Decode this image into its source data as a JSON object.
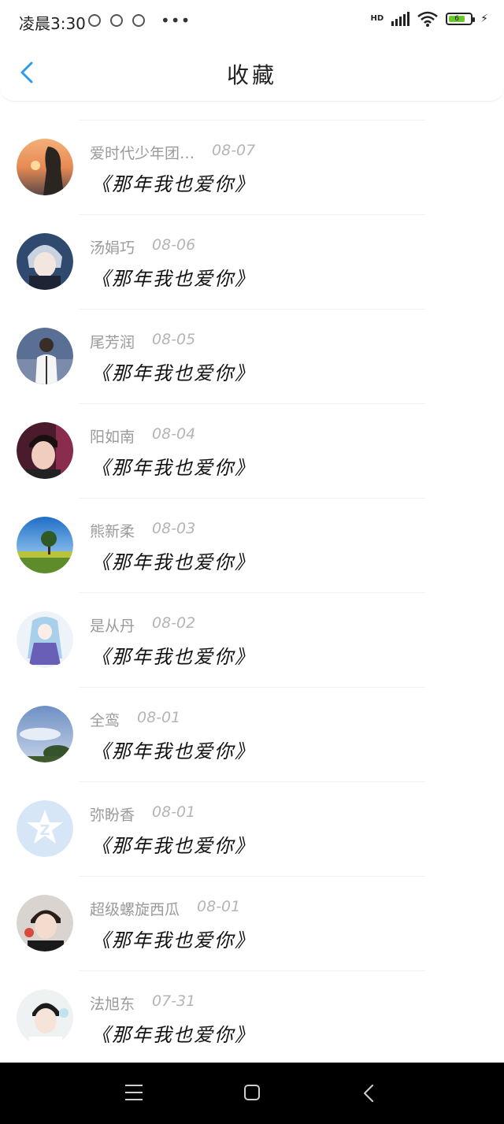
{
  "status_bar": {
    "time": "凌晨3:30",
    "more": "•••",
    "network": "HD",
    "battery_level": "6"
  },
  "header": {
    "title": "收藏"
  },
  "favorites": [
    {
      "user": "爱时代少年团…",
      "date": "08-07",
      "song": "《那年我也爱你》",
      "avatar": "sunset-portrait"
    },
    {
      "user": "汤娟巧",
      "date": "08-06",
      "song": "《那年我也爱你》",
      "avatar": "anime-boy"
    },
    {
      "user": "尾芳润",
      "date": "08-05",
      "song": "《那年我也爱你》",
      "avatar": "man-photo"
    },
    {
      "user": "阳如南",
      "date": "08-04",
      "song": "《那年我也爱你》",
      "avatar": "boy-photo"
    },
    {
      "user": "熊新柔",
      "date": "08-03",
      "song": "《那年我也爱你》",
      "avatar": "tree-landscape"
    },
    {
      "user": "是从丹",
      "date": "08-02",
      "song": "《那年我也爱你》",
      "avatar": "anime-girl"
    },
    {
      "user": "全鸾",
      "date": "08-01",
      "song": "《那年我也爱你》",
      "avatar": "sky-landscape"
    },
    {
      "user": "弥盼香",
      "date": "08-01",
      "song": "《那年我也爱你》",
      "avatar": "qzone-default"
    },
    {
      "user": "超级螺旋西瓜",
      "date": "08-01",
      "song": "《那年我也爱你》",
      "avatar": "boy-photo"
    },
    {
      "user": "法旭东",
      "date": "07-31",
      "song": "《那年我也爱你》",
      "avatar": "boy-photo"
    }
  ],
  "colors": {
    "accent": "#2b9cf0",
    "username": "#9a9a9a",
    "date": "#b5b5b5",
    "song": "#111111"
  }
}
